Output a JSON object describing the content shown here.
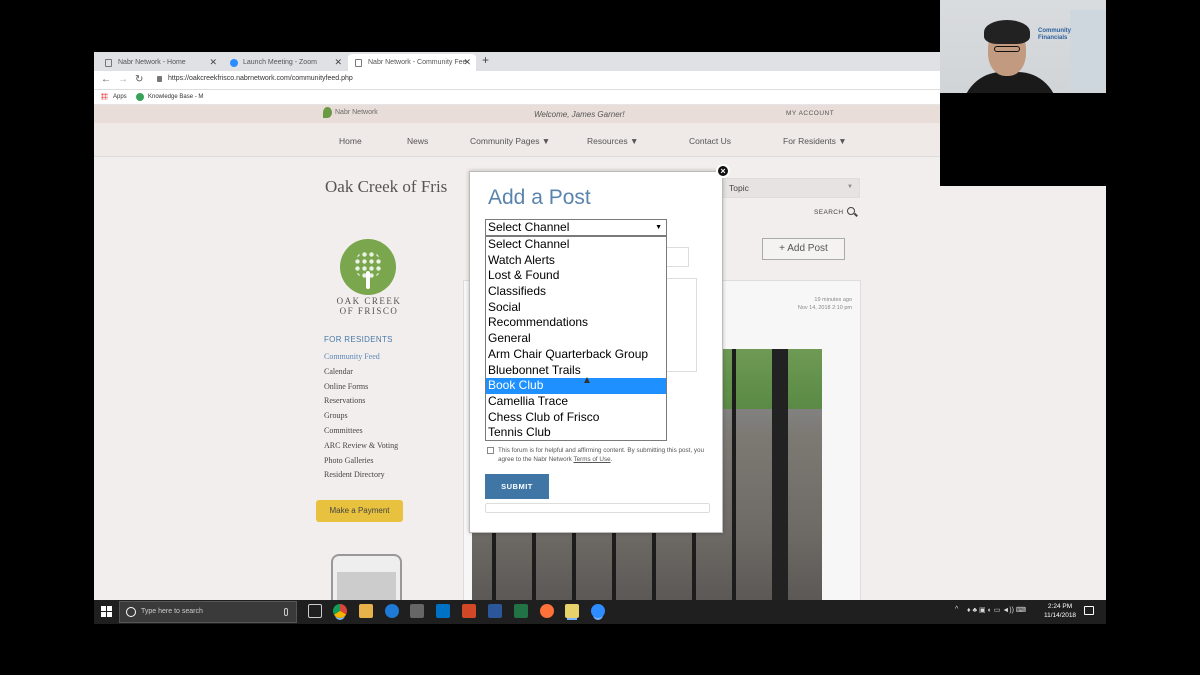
{
  "browser": {
    "tabs": [
      {
        "label": "Nabr Network - Home",
        "active": false
      },
      {
        "label": "Launch Meeting - Zoom",
        "active": false
      },
      {
        "label": "Nabr Network - Community Fee",
        "active": true
      }
    ],
    "new_tab": "+",
    "url": "https://oakcreekfrisco.nabrnetwork.com/communityfeed.php",
    "bookmarks": [
      "Apps",
      "Knowledge Base - M"
    ]
  },
  "site": {
    "brand": "Nabr Network",
    "welcome": "Welcome, James Garner!",
    "my_account": "MY ACCOUNT",
    "nav": [
      "Home",
      "News",
      "Community Pages ▼",
      "Resources ▼",
      "Contact Us",
      "For Residents ▼"
    ],
    "title": "Oak Creek of Fris",
    "topic_select": "Topic",
    "search": "SEARCH",
    "logo_text": [
      "OAK CREEK",
      "OF FRISCO"
    ],
    "sidebar_heading": "FOR RESIDENTS",
    "sidebar_links": [
      "Community Feed",
      "Calendar",
      "Online Forms",
      "Reservations",
      "Groups",
      "Committees",
      "ARC Review & Voting",
      "Photo Galleries",
      "Resident Directory"
    ],
    "payment_button": "Make a Payment",
    "add_post_button": "+ Add Post",
    "post_time": [
      "19 minutes ago",
      "Nov 14, 2018 2:10 pm"
    ]
  },
  "modal": {
    "title": "Add a Post",
    "select_value": "Select Channel",
    "options": [
      "Select Channel",
      "Watch Alerts",
      "Lost & Found",
      "Classifieds",
      "Social",
      "Recommendations",
      "General",
      "Arm Chair Quarterback Group",
      "Bluebonnet Trails",
      "Book Club",
      "Camellia Trace",
      "Chess Club of Frisco",
      "Tennis Club"
    ],
    "highlighted_option": "Book Club",
    "terms_text": "This forum is for helpful and affirming content. By submitting this post, you agree to the Nabr Network",
    "terms_link": "Terms of Use",
    "terms_end": ".",
    "submit": "SUBMIT",
    "close": "×"
  },
  "webcam": {
    "logo": [
      "Community",
      "Financials"
    ]
  },
  "taskbar": {
    "search_placeholder": "Type here to search",
    "time": "2:24 PM",
    "date": "11/14/2018"
  },
  "colors": {
    "accent_blue": "#3f76a6",
    "highlight": "#1e90ff",
    "logo_green": "#7aa74d",
    "payment_yellow": "#e8c23e"
  }
}
